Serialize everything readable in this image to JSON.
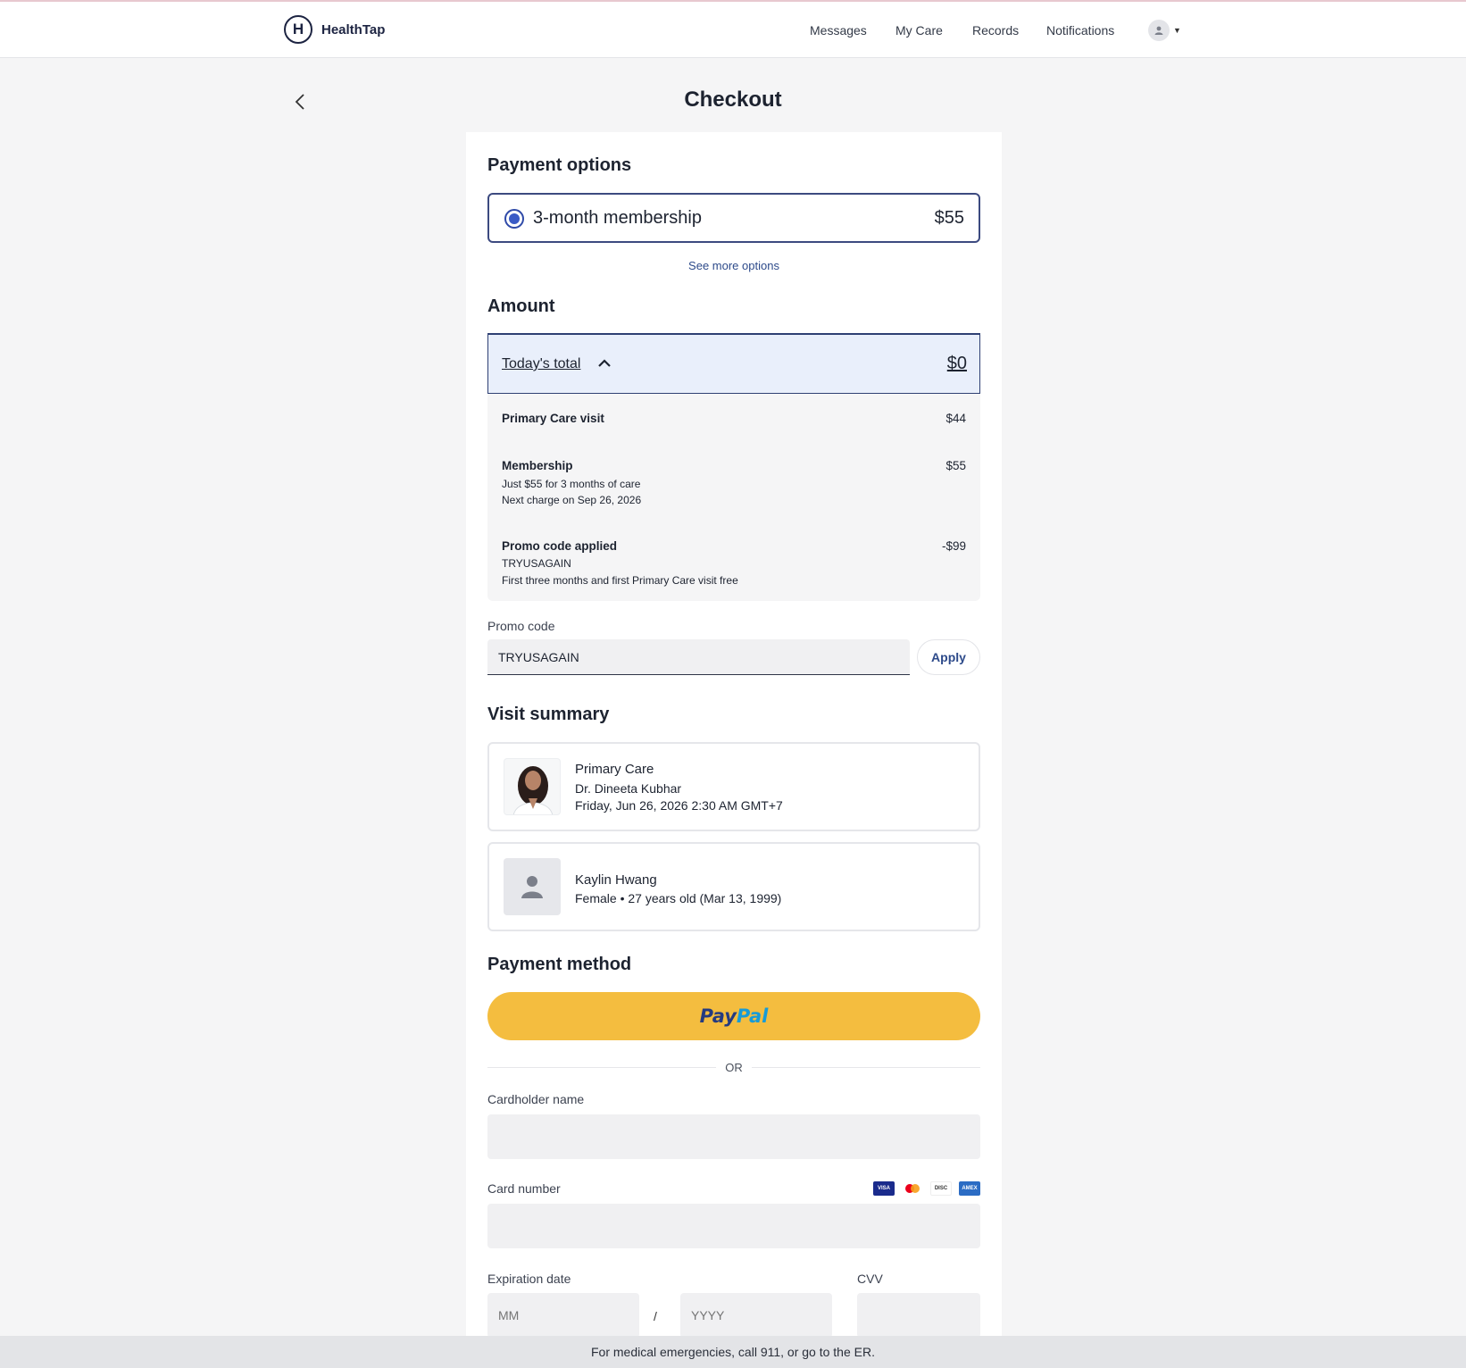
{
  "app": {
    "name": "HealthTap",
    "logo_letter": "H"
  },
  "nav": {
    "messages": "Messages",
    "my_care": "My Care",
    "records": "Records",
    "notifications": "Notifications"
  },
  "page": {
    "title": "Checkout"
  },
  "payment_options": {
    "title": "Payment options",
    "selected_plan": {
      "label": "3-month membership",
      "price": "$55"
    },
    "see_more": "See more options"
  },
  "amount": {
    "title": "Amount",
    "todays_total_label": "Today's total",
    "todays_total_value": "$0",
    "lines": [
      {
        "title": "Primary Care visit",
        "amount": "$44",
        "details": []
      },
      {
        "title": "Membership",
        "amount": "$55",
        "details": [
          "Just $55 for 3 months of care",
          "Next charge on Sep 26, 2026"
        ]
      },
      {
        "title": "Promo code applied",
        "amount": "-$99",
        "details": [
          "TRYUSAGAIN",
          "First three months and first Primary Care visit free"
        ]
      }
    ]
  },
  "promo": {
    "label": "Promo code",
    "value": "TRYUSAGAIN",
    "apply_label": "Apply"
  },
  "visit_summary": {
    "title": "Visit summary",
    "visit": {
      "type": "Primary Care",
      "doctor": "Dr. Dineeta Kubhar",
      "datetime": "Friday, Jun 26, 2026 2:30 AM GMT+7"
    },
    "patient": {
      "name": "Kaylin Hwang",
      "info": "Female • 27 years old (Mar 13, 1999)"
    }
  },
  "payment_method": {
    "title": "Payment method",
    "paypal_part1": "Pay",
    "paypal_part2": "Pal",
    "or_text": "OR",
    "cardholder_label": "Cardholder name",
    "card_number_label": "Card number",
    "card_brands": [
      "visa",
      "mastercard",
      "discover",
      "amex"
    ],
    "expiration_label": "Expiration date",
    "month_placeholder": "MM",
    "year_placeholder": "YYYY",
    "separator": "/",
    "cvv_label": "CVV"
  },
  "footer": {
    "text": "For medical emergencies, call 911, or go to the ER."
  },
  "colors": {
    "accent": "#2d4a8a",
    "paypal_yellow": "#f4bd3f",
    "selected_border": "#3c4a80",
    "total_bg": "#e9effb"
  }
}
